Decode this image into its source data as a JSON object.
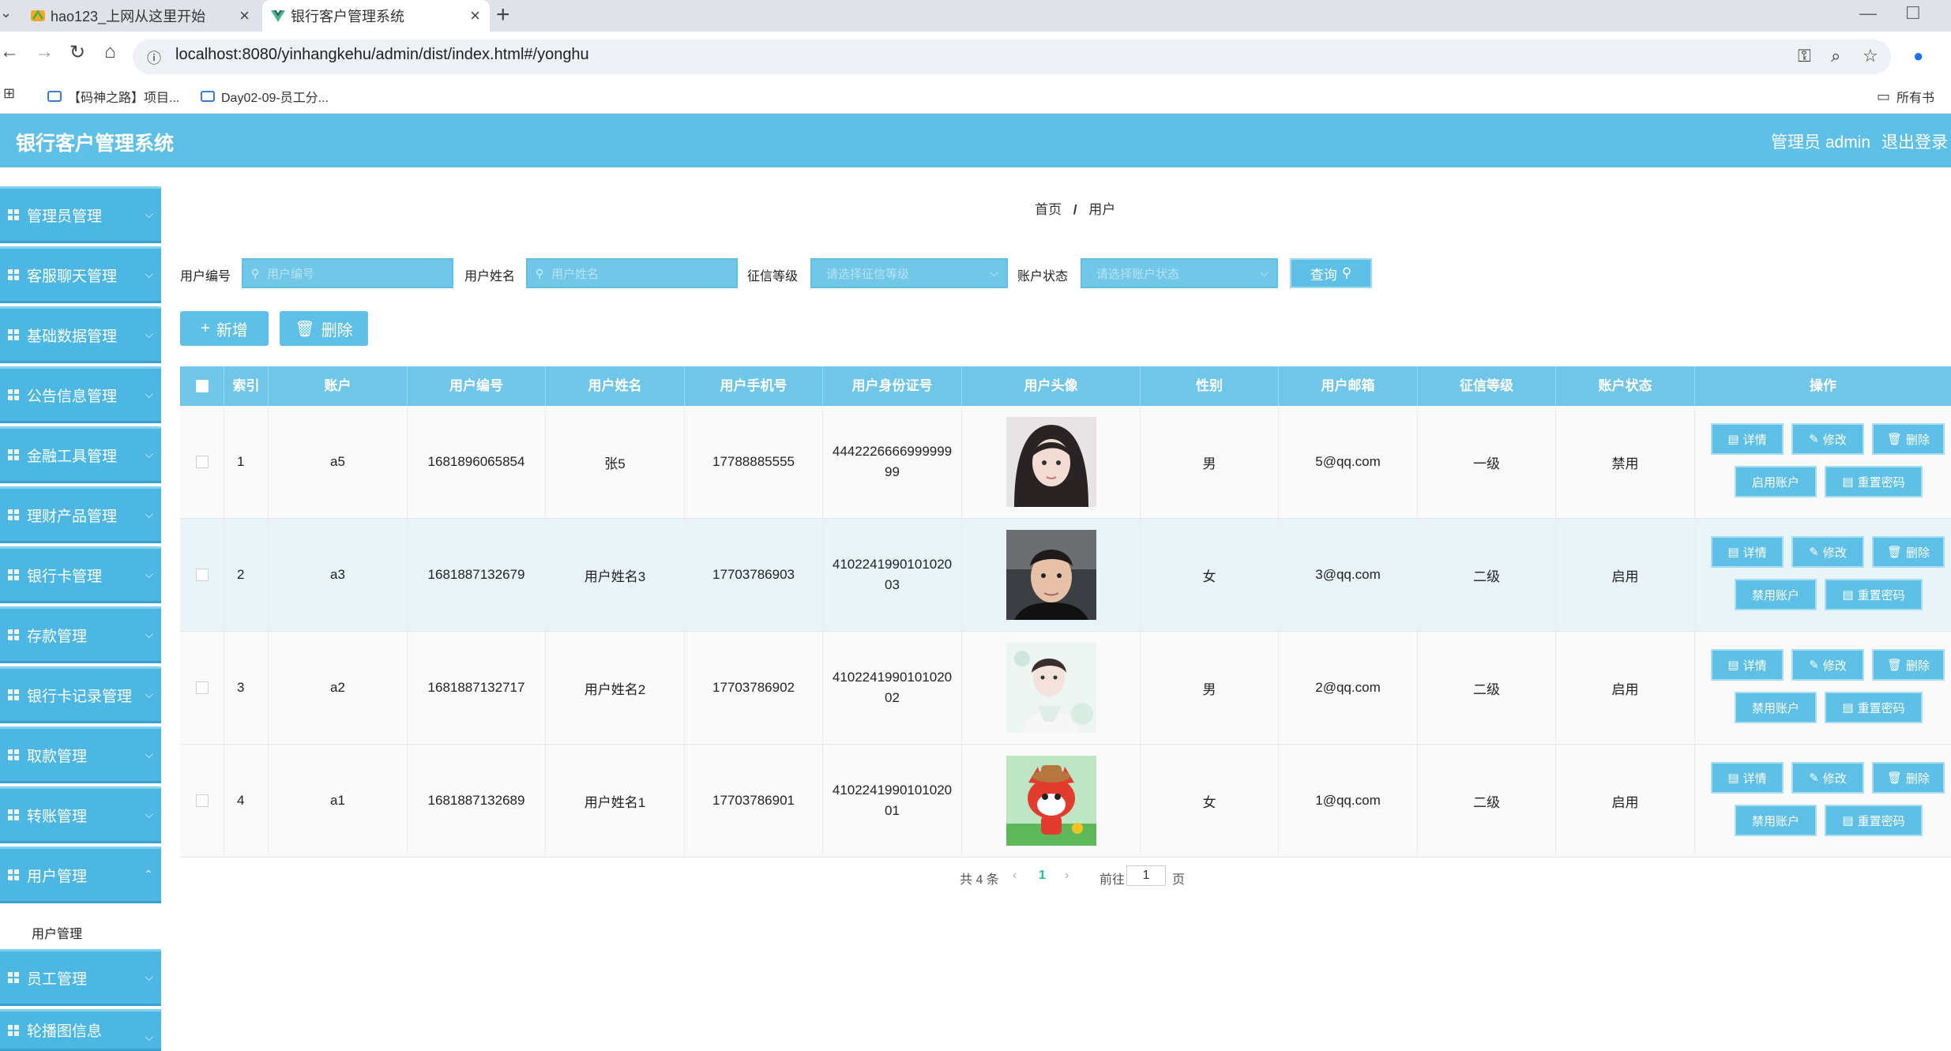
{
  "browser": {
    "tabs": [
      {
        "title": "hao123_上网从这里开始",
        "active": false
      },
      {
        "title": "银行客户管理系统",
        "active": true
      }
    ],
    "url": "localhost:8080/yinhangkehu/admin/dist/index.html#/yonghu",
    "bookmarks": [
      {
        "label": "【码神之路】项目..."
      },
      {
        "label": "Day02-09-员工分..."
      },
      {
        "label": "所有书"
      }
    ]
  },
  "app": {
    "title": "银行客户管理系统",
    "user_label": "管理员 admin",
    "logout_label": "退出登录"
  },
  "sidebar": {
    "items": [
      {
        "label": "管理员管理"
      },
      {
        "label": "客服聊天管理"
      },
      {
        "label": "基础数据管理"
      },
      {
        "label": "公告信息管理"
      },
      {
        "label": "金融工具管理"
      },
      {
        "label": "理财产品管理"
      },
      {
        "label": "银行卡管理"
      },
      {
        "label": "存款管理"
      },
      {
        "label": "银行卡记录管理"
      },
      {
        "label": "取款管理"
      },
      {
        "label": "转账管理"
      },
      {
        "label": "用户管理"
      },
      {
        "label": "员工管理"
      },
      {
        "label": "轮播图信息"
      }
    ],
    "sub_item": "用户管理"
  },
  "breadcrumb": {
    "home": "首页",
    "sep": "/",
    "current": "用户"
  },
  "filters": {
    "user_no": {
      "label": "用户编号",
      "placeholder": "用户编号"
    },
    "user_name": {
      "label": "用户姓名",
      "placeholder": "用户姓名"
    },
    "credit": {
      "label": "征信等级",
      "placeholder": "请选择征信等级"
    },
    "status": {
      "label": "账户状态",
      "placeholder": "请选择账户状态"
    },
    "query_label": "查询"
  },
  "actions": {
    "add_label": "新增",
    "delete_label": "删除"
  },
  "table": {
    "headers": [
      "索引",
      "账户",
      "用户编号",
      "用户姓名",
      "用户手机号",
      "用户身份证号",
      "用户头像",
      "性别",
      "用户邮箱",
      "征信等级",
      "账户状态",
      "操作"
    ],
    "rows": [
      {
        "index": "1",
        "account": "a5",
        "user_no": "1681896065854",
        "name": "张5",
        "phone": "17788885555",
        "id_card": "444222666699999999",
        "gender": "男",
        "email": "5@qq.com",
        "credit": "一级",
        "status": "禁用",
        "toggle_label": "启用账户"
      },
      {
        "index": "2",
        "account": "a3",
        "user_no": "1681887132679",
        "name": "用户姓名3",
        "phone": "17703786903",
        "id_card": "410224199010102003",
        "gender": "女",
        "email": "3@qq.com",
        "credit": "二级",
        "status": "启用",
        "toggle_label": "禁用账户"
      },
      {
        "index": "3",
        "account": "a2",
        "user_no": "1681887132717",
        "name": "用户姓名2",
        "phone": "17703786902",
        "id_card": "410224199010102002",
        "gender": "男",
        "email": "2@qq.com",
        "credit": "二级",
        "status": "启用",
        "toggle_label": "禁用账户"
      },
      {
        "index": "4",
        "account": "a1",
        "user_no": "1681887132689",
        "name": "用户姓名1",
        "phone": "17703786901",
        "id_card": "410224199010102001",
        "gender": "女",
        "email": "1@qq.com",
        "credit": "二级",
        "status": "启用",
        "toggle_label": "禁用账户"
      }
    ],
    "op_labels": {
      "detail": "详情",
      "edit": "修改",
      "delete": "删除",
      "reset": "重置密码"
    }
  },
  "pagination": {
    "total": "共 4 条",
    "current": "1",
    "goto": "前往",
    "page_value": "1",
    "page_unit": "页"
  },
  "colors": {
    "primary": "#5ec0e6",
    "header": "#5ec0e6",
    "menu": "#4bb7e2",
    "page_active": "#1dbfa0"
  }
}
